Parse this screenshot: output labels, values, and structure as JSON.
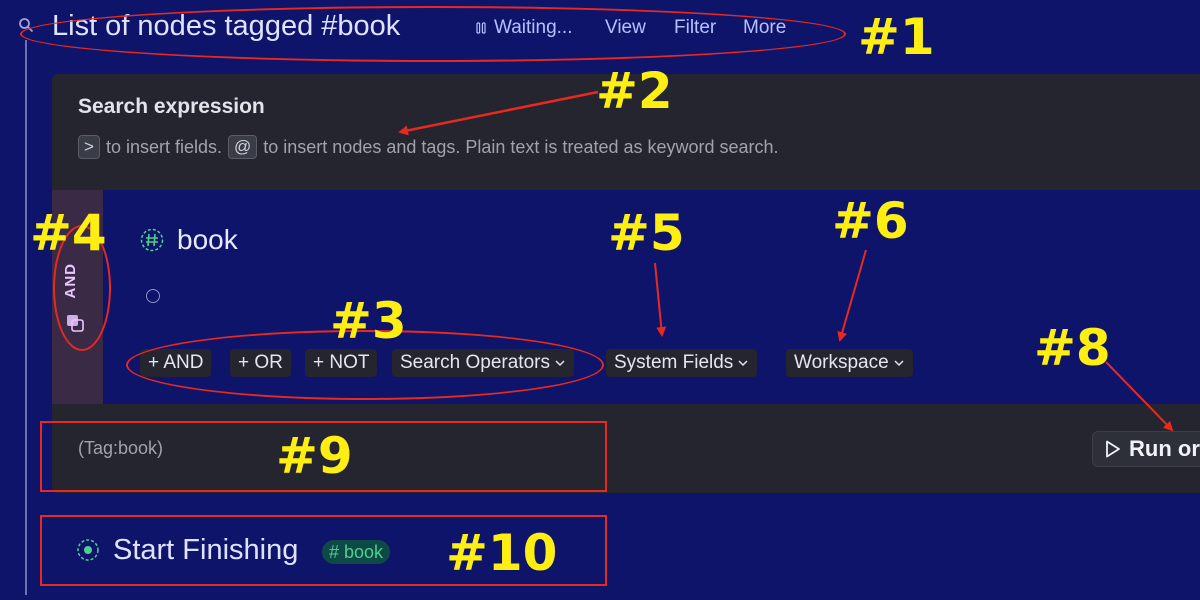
{
  "header": {
    "title": "List of nodes tagged #book",
    "status": "Waiting...",
    "actions": [
      "View",
      "Filter",
      "More"
    ],
    "icons": {
      "search": "search-icon",
      "status": "pause-icon"
    }
  },
  "search_panel": {
    "title": "Search expression",
    "hint_key_1": ">",
    "hint_text_1": "to insert fields.",
    "hint_key_2": "@",
    "hint_text_2": "to insert nodes and tags. Plain text is treated as keyword search."
  },
  "expression": {
    "operator": "AND",
    "tag_name": "book",
    "operator_buttons": [
      "+ AND",
      "+ OR",
      "+ NOT"
    ],
    "dropdowns": [
      "Search Operators",
      "System Fields",
      "Workspace"
    ]
  },
  "results": {
    "query": "(Tag:book)",
    "run_label": "Run or"
  },
  "node": {
    "title": "Start Finishing",
    "tag": "# book"
  },
  "annotations": [
    "#1",
    "#2",
    "#3",
    "#4",
    "#5",
    "#6",
    "#8",
    "#9",
    "#10"
  ],
  "colors": {
    "background": "#0f146b",
    "panel": "#24252e",
    "annotation_red": "#e8291f",
    "annotation_yellow": "#ffee12",
    "tag_green": "#4ed08e"
  }
}
